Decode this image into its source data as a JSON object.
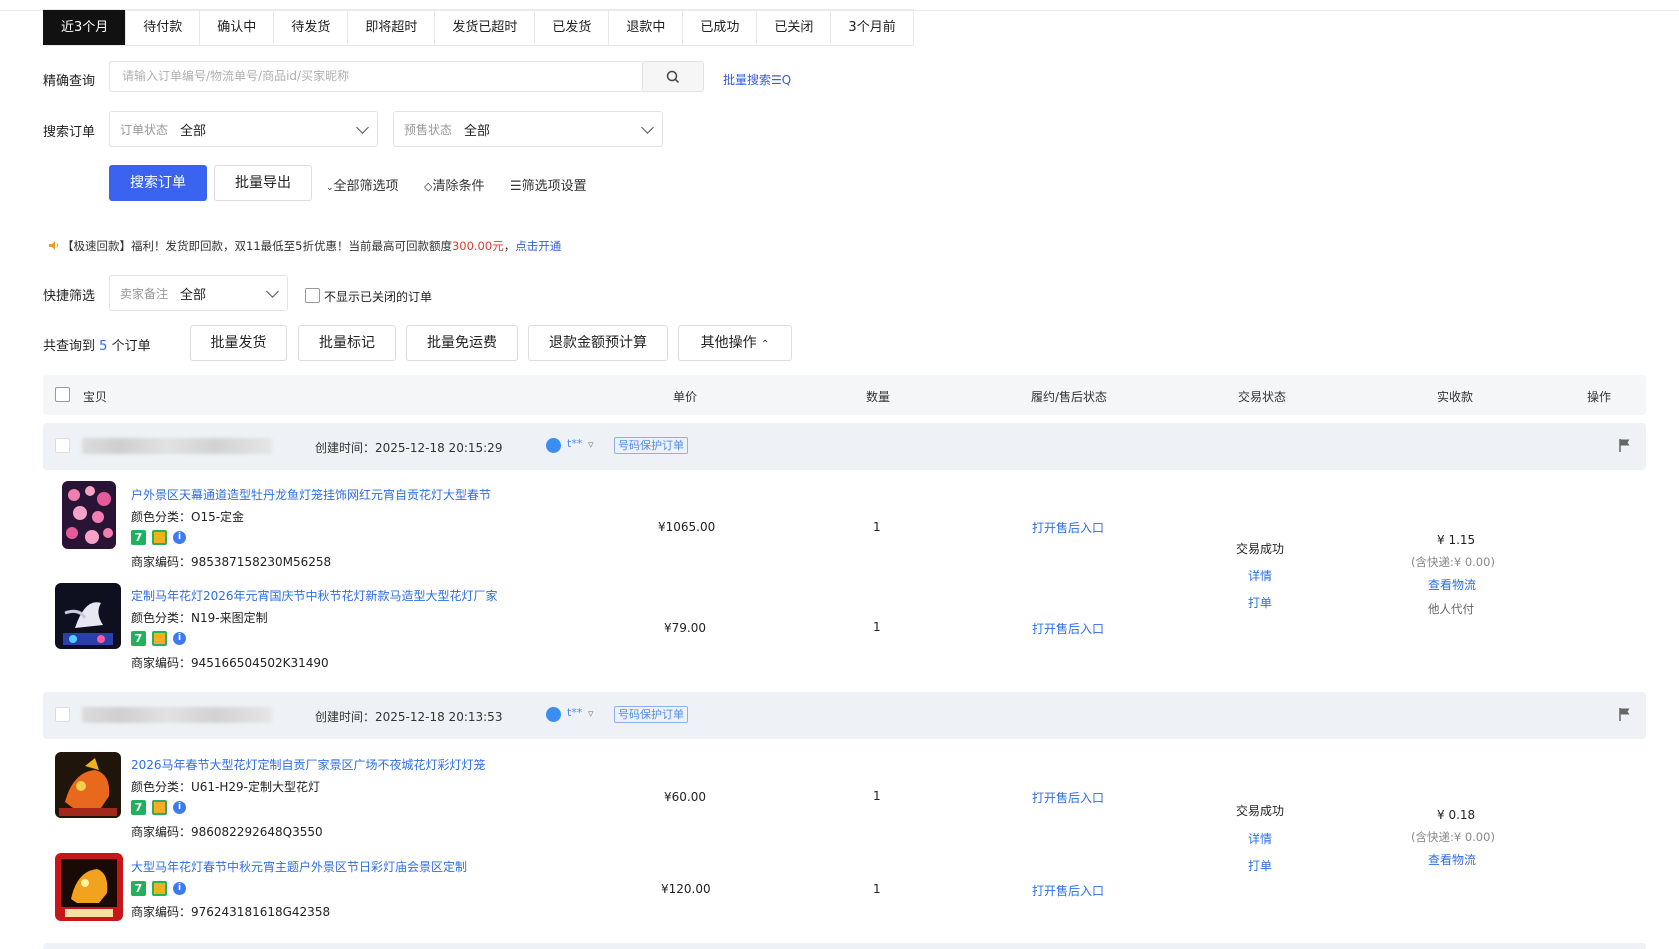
{
  "tabs": [
    "近3个月",
    "待付款",
    "确认中",
    "待发货",
    "即将超时",
    "发货已超时",
    "已发货",
    "退款中",
    "已成功",
    "已关闭",
    "3个月前"
  ],
  "active_tab": 0,
  "query": {
    "label": "精确查询",
    "placeholder": "请输入订单编号/物流单号/商品id/买家昵称",
    "batch_search": "批量搜索☰Q"
  },
  "search_order": {
    "label": "搜索订单",
    "order_status_label": "订单状态",
    "order_status_value": "全部",
    "presale_label": "预售状态",
    "presale_value": "全部"
  },
  "actions": {
    "search": "搜索订单",
    "export": "批量导出",
    "all_filters": "全部筛选项",
    "clear": "清除条件",
    "filter_settings": "筛选项设置"
  },
  "notice": {
    "prefix": "【极速回款】福利！发货即回款，双11最低至5折优惠！当前最高可回款额度",
    "amount": "300.00元",
    "sep": "，",
    "link": "点击开通"
  },
  "quick_filter": {
    "label": "快捷筛选",
    "note_label": "卖家备注",
    "note_value": "全部",
    "hide_closed": "不显示已关闭的订单"
  },
  "summary": {
    "prefix": "共查询到",
    "count": "5",
    "suffix": "个订单"
  },
  "batch": {
    "ship": "批量发货",
    "mark": "批量标记",
    "free_ship": "批量免运费",
    "refund_calc": "退款金额预计算",
    "other": "其他操作"
  },
  "table_header": {
    "item": "宝贝",
    "unit_price": "单价",
    "quantity": "数量",
    "after_sale": "履约/售后状态",
    "trade_status": "交易状态",
    "received": "实收款",
    "ops": "操作"
  },
  "orders": [
    {
      "created": "创建时间：2025-12-18 20:15:29",
      "buyer": "t**",
      "badge": "号码保护订单",
      "status": "交易成功",
      "detail": "详情",
      "print": "打单",
      "amount": "¥ 1.15",
      "shipping": "(含快递:¥ 0.00)",
      "logistics": "查看物流",
      "paid_by": "他人代付",
      "items": [
        {
          "title": "户外景区天幕通道造型牡丹龙鱼灯笼挂饰网红元宵自贡花灯大型春节",
          "color": "颜色分类：O15-定金",
          "code": "商家编码：985387158230M56258",
          "price": "¥1065.00",
          "qty": "1",
          "after": "打开售后入口"
        },
        {
          "title": "定制马年花灯2026年元宵国庆节中秋节花灯新款马造型大型花灯厂家",
          "color": "颜色分类：N19-来图定制",
          "code": "商家编码：945166504502K31490",
          "price": "¥79.00",
          "qty": "1",
          "after": "打开售后入口"
        }
      ]
    },
    {
      "created": "创建时间：2025-12-18 20:13:53",
      "buyer": "t**",
      "badge": "号码保护订单",
      "status": "交易成功",
      "detail": "详情",
      "print": "打单",
      "amount": "¥ 0.18",
      "shipping": "(含快递:¥ 0.00)",
      "logistics": "查看物流",
      "items": [
        {
          "title": "2026马年春节大型花灯定制自贡厂家景区广场不夜城花灯彩灯灯笼",
          "color": "颜色分类：U61-H29-定制大型花灯",
          "code": "商家编码：986082292648Q3550",
          "price": "¥60.00",
          "qty": "1",
          "after": "打开售后入口"
        },
        {
          "title": "大型马年花灯春节中秋元宵主题户外景区节日彩灯庙会景区定制",
          "code": "商家编码：976243181618G42358",
          "price": "¥120.00",
          "qty": "1",
          "after": "打开售后入口"
        }
      ]
    }
  ],
  "colors": {
    "primary": "#3a63ef",
    "link": "#2e6ee6",
    "active_tab": "#111111",
    "notice_red": "#e23a2e",
    "row_head_bg": "#eef1f6"
  }
}
